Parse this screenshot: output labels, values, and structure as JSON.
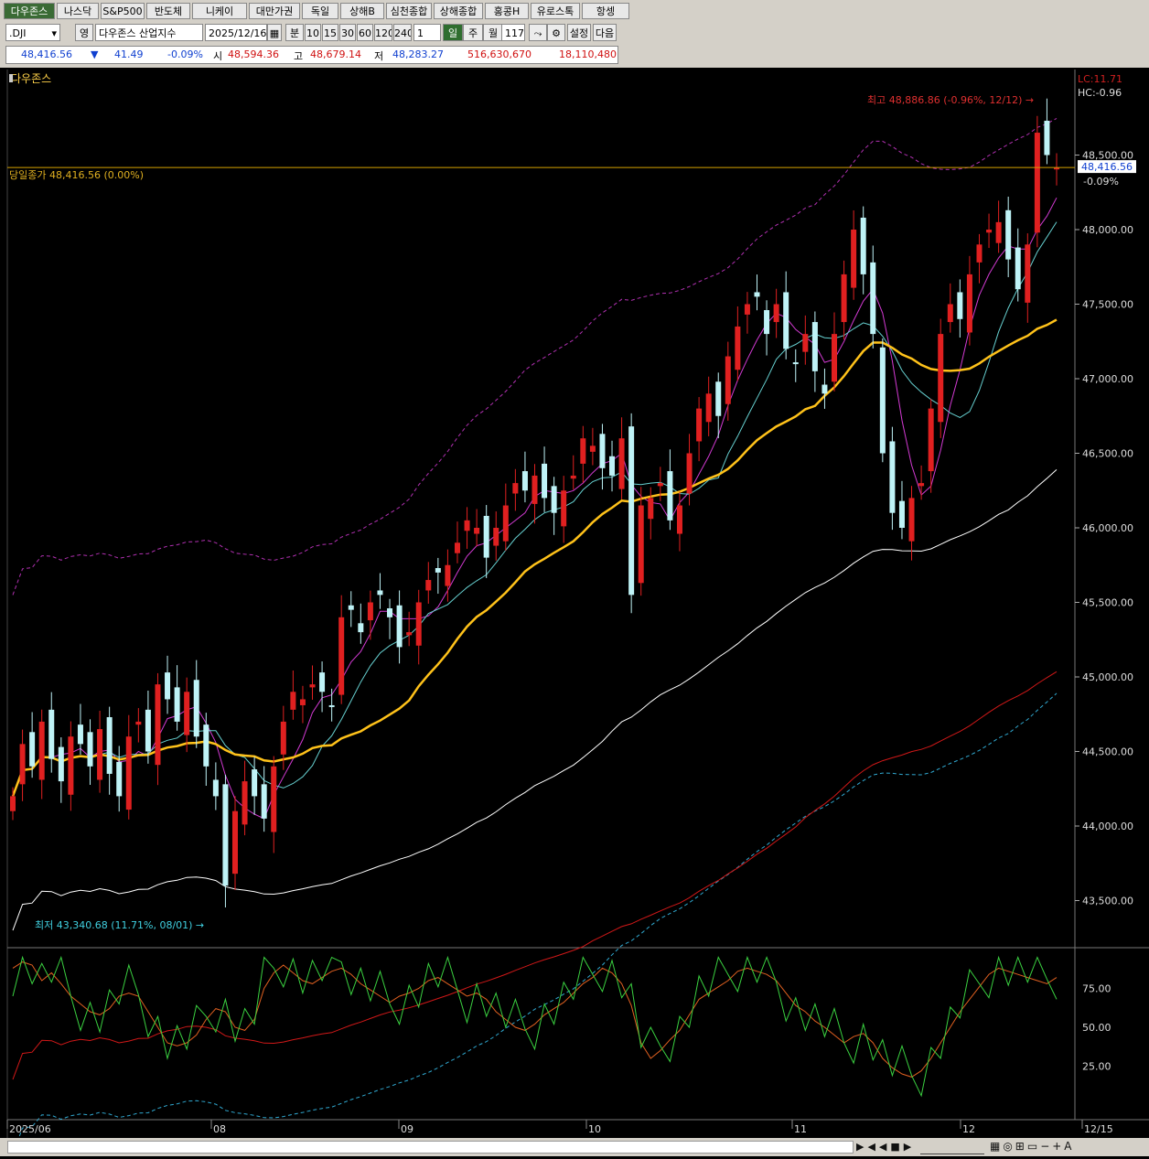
{
  "tabs": [
    "다우존스",
    "나스닥",
    "S&P500",
    "반도체",
    "니케이",
    "대만가권",
    "독일",
    "상해B",
    "심천종합",
    "상해종합",
    "홍콩H",
    "유로스톡",
    "항셍"
  ],
  "toolbar": {
    "symbol": ".DJI",
    "lang_btn": "영",
    "name": "다우존스 산업지수",
    "date": "2025/12/16",
    "period_buttons": [
      "분",
      "10",
      "15",
      "30",
      "60",
      "120",
      "240"
    ],
    "count": "1",
    "day_btn": "일",
    "week_btn": "주",
    "month_btn": "월",
    "bars": "117",
    "settings": "설정",
    "next": "다음"
  },
  "quote": {
    "price": "48,416.56",
    "arrow": "▼",
    "change": "41.49",
    "pct": "-0.09%",
    "open_label": "시",
    "open": "48,594.36",
    "high_label": "고",
    "high": "48,679.14",
    "low_label": "저",
    "low": "48,283.27",
    "volume": "516,630,670",
    "amount": "18,110,480"
  },
  "chart": {
    "title": "다우존스",
    "close_label": "당일종가 48,416.56 (0.00%)",
    "high_label": "최고 48,886.86 (-0.96%, 12/12)",
    "low_label": "최저 43,340.68 (11.71%, 08/01)",
    "lc": "LC:11.71",
    "hc": "HC:-0.96",
    "price_tag": "48,416.56",
    "price_pct": "-0.09%",
    "yticks": [
      "48,500.00",
      "48,000.00",
      "47,500.00",
      "47,000.00",
      "46,500.00",
      "46,000.00",
      "45,500.00",
      "45,000.00",
      "44,500.00",
      "44,000.00",
      "43,500.00"
    ],
    "osc_ticks": [
      "75.00",
      "50.00",
      "25.00"
    ],
    "x_labels": [
      "2025/06",
      "08",
      "09",
      "10",
      "11",
      "12",
      "12/15"
    ]
  },
  "chart_data": {
    "type": "candlestick",
    "ylim": [
      43300,
      48900
    ],
    "last_close": 48416.56,
    "high": 48886.86,
    "low": 43340.68,
    "colors": {
      "up": "#e02020",
      "down": "#bff3f7",
      "ma_thick": "#ffc21a",
      "ma_white": "#ffffff",
      "ma_red": "#d01818"
    }
  }
}
